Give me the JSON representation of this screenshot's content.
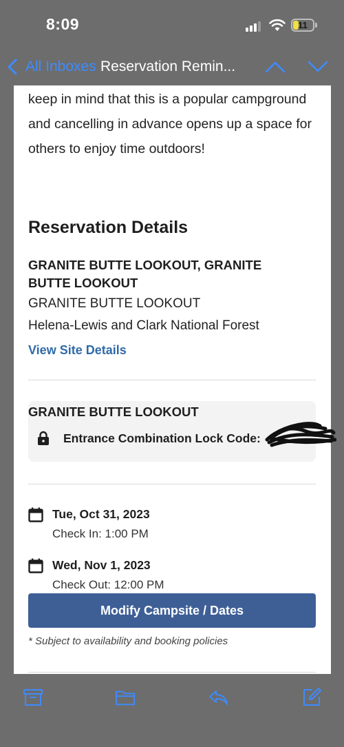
{
  "status": {
    "time": "8:09",
    "battery": "11"
  },
  "nav": {
    "back_label": "All Inboxes",
    "title": "Reservation Remin..."
  },
  "email": {
    "intro": "keep in mind that this is a popular campground and cancelling in advance opens up a space for others to enjoy time outdoors!",
    "section_title": "Reservation Details",
    "site_name": "GRANITE BUTTE LOOKOUT, GRANITE BUTTE LOOKOUT",
    "site_line1": "GRANITE BUTTE LOOKOUT",
    "site_line2": "Helena-Lewis and Clark National Forest",
    "view_link": "View Site Details",
    "lock_heading": "GRANITE BUTTE LOOKOUT",
    "lock_label": "Entrance Combination Lock Code:",
    "checkin_date": "Tue, Oct 31, 2023",
    "checkin_time": "Check In: 1:00 PM",
    "checkout_date": "Wed, Nov 1, 2023",
    "checkout_time": "Check Out: 12:00 PM",
    "modify_button": "Modify Campsite / Dates",
    "footnote": "* Subject to availability and booking policies"
  },
  "icons": {
    "back": "chevron-left-icon",
    "prev": "chevron-up-icon",
    "next": "chevron-down-icon",
    "lock": "lock-icon",
    "calendar": "calendar-icon",
    "archive": "archive-icon",
    "folder": "folder-icon",
    "reply": "reply-icon",
    "compose": "compose-icon"
  },
  "colors": {
    "accent": "#3d8bff",
    "link": "#2f6aa8",
    "button": "#3e5f96",
    "chrome": "#6d6d6d"
  }
}
